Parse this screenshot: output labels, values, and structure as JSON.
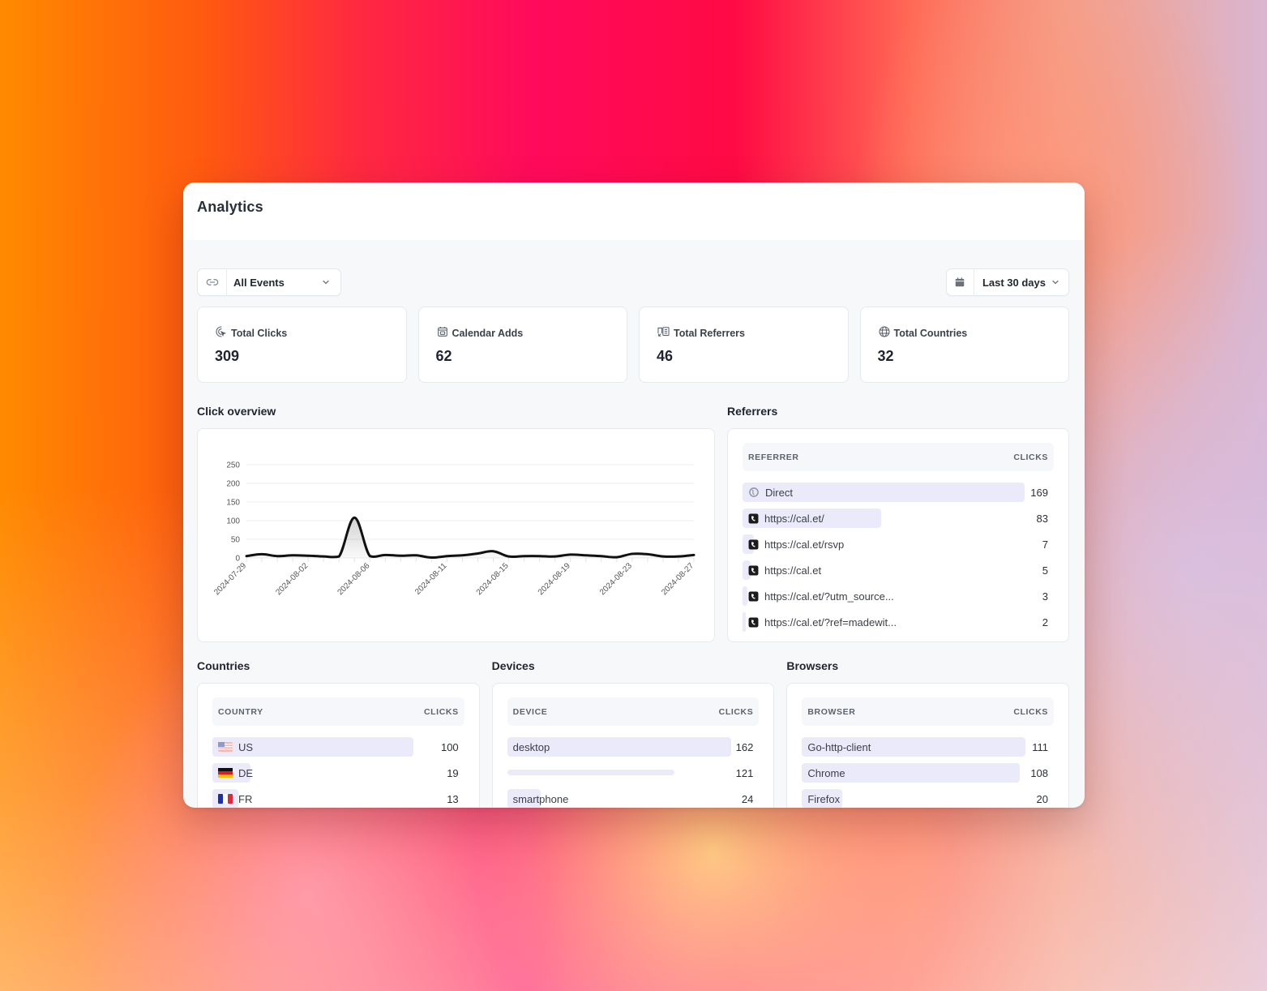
{
  "header": {
    "title": "Analytics"
  },
  "filters": {
    "event_select": {
      "icon": "link-icon",
      "value": "All Events"
    },
    "range_select": {
      "icon": "calendar-icon",
      "value": "Last 30 days"
    }
  },
  "stats": [
    {
      "icon": "click-cursor-icon",
      "label": "Total Clicks",
      "value": "309"
    },
    {
      "icon": "calendar-icon",
      "label": "Calendar Adds",
      "value": "62"
    },
    {
      "icon": "referrer-icon",
      "label": "Total Referrers",
      "value": "46"
    },
    {
      "icon": "globe-icon",
      "label": "Total Countries",
      "value": "32"
    }
  ],
  "click_overview": {
    "title": "Click overview"
  },
  "chart_data": {
    "type": "area",
    "title": "Click overview",
    "xlabel": "",
    "ylabel": "",
    "ylim": [
      0,
      250
    ],
    "yticks": [
      0,
      50,
      100,
      150,
      200,
      250
    ],
    "grid": true,
    "legend": "none",
    "x": [
      "2024-07-29",
      "2024-07-30",
      "2024-07-31",
      "2024-08-01",
      "2024-08-02",
      "2024-08-03",
      "2024-08-04",
      "2024-08-05",
      "2024-08-06",
      "2024-08-07",
      "2024-08-08",
      "2024-08-09",
      "2024-08-10",
      "2024-08-11",
      "2024-08-12",
      "2024-08-13",
      "2024-08-14",
      "2024-08-15",
      "2024-08-16",
      "2024-08-17",
      "2024-08-18",
      "2024-08-19",
      "2024-08-20",
      "2024-08-21",
      "2024-08-22",
      "2024-08-23",
      "2024-08-24",
      "2024-08-25",
      "2024-08-26",
      "2024-08-27"
    ],
    "xtick_labels": [
      "2024-07-29",
      "2024-08-02",
      "2024-08-06",
      "2024-08-11",
      "2024-08-15",
      "2024-08-19",
      "2024-08-23",
      "2024-08-27"
    ],
    "series": [
      {
        "name": "Clicks",
        "values": [
          5,
          10,
          5,
          7,
          6,
          4,
          4,
          108,
          5,
          8,
          6,
          7,
          1,
          5,
          7,
          12,
          18,
          4,
          5,
          5,
          4,
          9,
          7,
          5,
          2,
          11,
          10,
          4,
          4,
          8
        ]
      }
    ]
  },
  "referrers": {
    "title": "Referrers",
    "columns": [
      "REFERRER",
      "CLICKS"
    ],
    "max": 169,
    "rows": [
      {
        "icon": "globe-icon",
        "name": "Direct",
        "clicks": 169
      },
      {
        "icon": "cal-logo-icon",
        "name": "https://cal.et/",
        "clicks": 83
      },
      {
        "icon": "cal-logo-icon",
        "name": "https://cal.et/rsvp",
        "clicks": 7
      },
      {
        "icon": "cal-logo-icon",
        "name": "https://cal.et",
        "clicks": 5
      },
      {
        "icon": "cal-logo-icon",
        "name": "https://cal.et/?utm_source...",
        "clicks": 3
      },
      {
        "icon": "cal-logo-icon",
        "name": "https://cal.et/?ref=madewit...",
        "clicks": 2
      }
    ]
  },
  "countries": {
    "title": "Countries",
    "columns": [
      "COUNTRY",
      "CLICKS"
    ],
    "max": 100,
    "rows": [
      {
        "flag": "us-flag-icon",
        "name": "US",
        "clicks": 100
      },
      {
        "flag": "de-flag-icon",
        "name": "DE",
        "clicks": 19
      },
      {
        "flag": "fr-flag-icon",
        "name": "FR",
        "clicks": 13
      }
    ]
  },
  "devices": {
    "title": "Devices",
    "columns": [
      "DEVICE",
      "CLICKS"
    ],
    "max": 162,
    "rows": [
      {
        "name": "desktop",
        "clicks": 162
      },
      {
        "name": "",
        "clicks": 121
      },
      {
        "name": "smartphone",
        "clicks": 24
      }
    ]
  },
  "browsers": {
    "title": "Browsers",
    "columns": [
      "BROWSER",
      "CLICKS"
    ],
    "max": 111,
    "rows": [
      {
        "name": "Go-http-client",
        "clicks": 111
      },
      {
        "name": "Chrome",
        "clicks": 108
      },
      {
        "name": "Firefox",
        "clicks": 20
      }
    ]
  },
  "colors": {
    "bar_fill": "#ebeafa",
    "line": "#111111",
    "grid": "#ececec",
    "panel_bg": "#ffffff",
    "page_bg": "#f6f8fa"
  }
}
